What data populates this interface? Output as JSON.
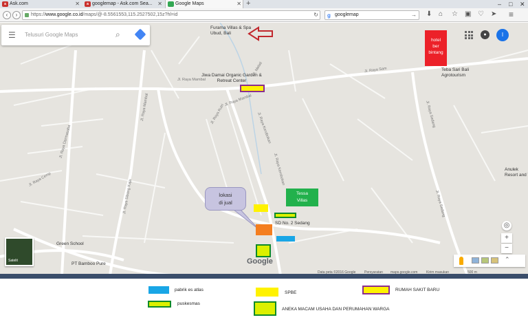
{
  "browser": {
    "tabs": [
      {
        "label": "Ask.com",
        "active": false
      },
      {
        "label": "googlemap - Ask.com Sea...",
        "active": false
      },
      {
        "label": "Google Maps",
        "active": true
      }
    ],
    "new_tab": "+",
    "url_host": "www.google.co.id",
    "url_prefix": "https://",
    "url_rest": "/maps/@-8.5561553,115.2527502,15z?hl=id",
    "search_engine_query": "googlemap"
  },
  "maps_ui": {
    "search_placeholder": "Telusuri Google Maps",
    "satellite_label": "Satelit",
    "google_logo": "Google",
    "zoom_in": "+",
    "zoom_out": "−",
    "account_initial": "I",
    "attribution": [
      "Data peta ©2016 Google",
      "Persyaratan",
      "maps.google.com",
      "Kirim masukan",
      "500 m"
    ]
  },
  "places": {
    "furama": "Furama Villas & Spa Ubud, Bali",
    "jiwa_damai": "Jiwa Damai Organic Garden & Retreat Center",
    "teba_sari": "Teba Sari Bali Agrotourism",
    "sd_no2": "SD No. 2 Sedang",
    "green_school": "Green School",
    "bamboo_pure": "PT Bamboo Pure",
    "anulek": "Anulek Resort and Vi"
  },
  "roads": {
    "r1": "Jl. Raya Mambal",
    "r2": "Jl. Raya Sam",
    "r3": "Jl. Raya Kerobokan",
    "r4": "Jl. Raya Sedang",
    "r5": "Jl. Raya Sibang Kaja",
    "r6": "Jl. Raya Cemp",
    "r7": "Jl. Raya Darmasaba",
    "r8": "Jl. Raya Kutri",
    "r9": "Jl. Melati"
  },
  "callouts": {
    "hotel_line1": "hotel",
    "hotel_line2": "ber",
    "hotel_line3": "bintang",
    "lokasi_line1": "lokasi",
    "lokasi_line2": "di jual",
    "tessa_line1": "Tessa",
    "tessa_line2": "Villas"
  },
  "legend": {
    "items": [
      {
        "label": "pabrik es atlas",
        "color": "#19a6e6"
      },
      {
        "label": "puskesmas",
        "color": "#dcf000"
      },
      {
        "label": "SPBE",
        "color": "#fff200"
      },
      {
        "label": "ANEKA MACAM USAHA DAN PERUMAHAN WARGA",
        "color": "#dcf000"
      },
      {
        "label": "RUMAH SAKIT BARU",
        "color": "#fff200"
      }
    ]
  },
  "colors": {
    "hotel": "#ec2129",
    "tessa": "#22b14c",
    "orange_plot": "#f47e20",
    "arrow": "#c1272d",
    "map_bg": "#e6e4df"
  }
}
